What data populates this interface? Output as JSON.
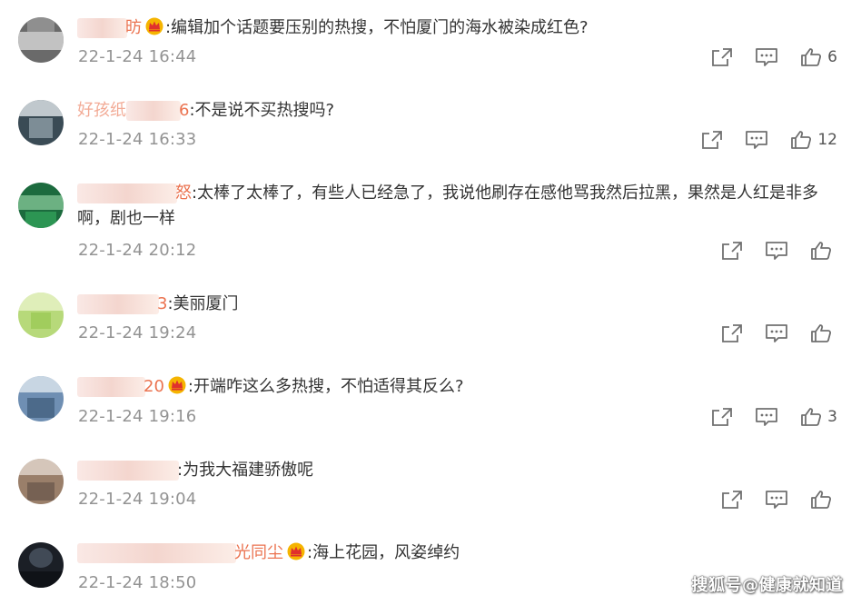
{
  "comments": [
    {
      "name_visible": "昉",
      "has_vip": true,
      "text": ":编辑加个话题要压别的热搜，不怕厦门的海水被染成红色?",
      "time": "22-1-24 16:44",
      "likes": "6",
      "avatar": [
        "#6a6a6a",
        "#d8d8d8",
        "#a0a0a0"
      ]
    },
    {
      "name_visible": "好孩纸",
      "name_suffix": "6",
      "has_vip": false,
      "text": ":不是说不买热搜吗?",
      "time": "22-1-24 16:33",
      "likes": "12",
      "avatar": [
        "#3a4b55",
        "#cfd6da",
        "#8f9ea6"
      ]
    },
    {
      "name_visible": "",
      "name_suffix": "怒",
      "has_vip": false,
      "text": ":太棒了太棒了，有些人已经急了，我说他刷存在感他骂我然后拉黑，果然是人红是非多啊，剧也一样",
      "time": "22-1-24 20:12",
      "likes": "",
      "avatar": [
        "#1c6b3e",
        "#8fcf9f",
        "#2f9a55"
      ]
    },
    {
      "name_visible": "",
      "name_suffix": "3",
      "has_vip": false,
      "text": ":美丽厦门",
      "time": "22-1-24 19:24",
      "likes": "",
      "avatar": [
        "#b7d97a",
        "#e8f3c9",
        "#9fcb5a"
      ]
    },
    {
      "name_visible": "",
      "name_suffix": "20",
      "has_vip": true,
      "text": ":开端咋这么多热搜，不怕适得其反么?",
      "time": "22-1-24 19:16",
      "likes": "3",
      "avatar": [
        "#6f8fb3",
        "#dfe7ef",
        "#44607f"
      ]
    },
    {
      "name_visible": "",
      "name_suffix": "",
      "has_vip": false,
      "text": ":为我大福建骄傲呢",
      "time": "22-1-24 19:04",
      "likes": "",
      "avatar": [
        "#9a7f6a",
        "#e4d8ce",
        "#6d5a4d"
      ]
    },
    {
      "name_visible": "",
      "name_suffix": "光同尘",
      "has_vip": true,
      "text": ":海上花园，风姿绰约",
      "time": "22-1-24 18:50",
      "likes": "",
      "avatar": [
        "#1b1f26",
        "#4b5563",
        "#0e1116"
      ]
    }
  ],
  "watermark": "搜狐号@健康就知道",
  "colors": {
    "name": "#eb7350",
    "time": "#939393",
    "icon": "#707070",
    "vip_gold": "#f5b400",
    "vip_red": "#e0312d"
  }
}
